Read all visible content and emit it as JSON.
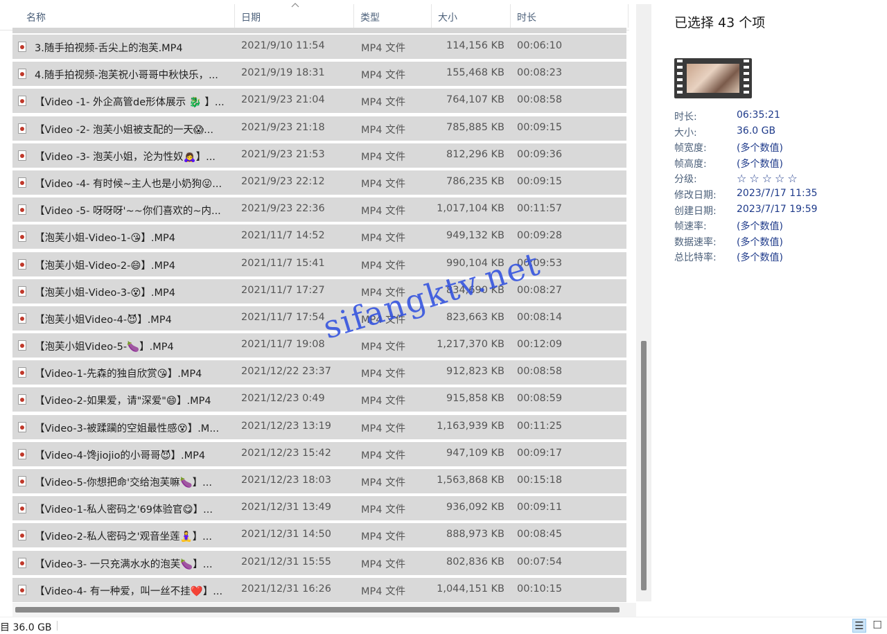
{
  "columns": {
    "name": "名称",
    "date": "日期",
    "type": "类型",
    "size": "大小",
    "duration": "时长"
  },
  "rows": [
    {
      "name": "3.随手拍视频-舌尖上的泡芙.MP4",
      "date": "2021/9/10 11:54",
      "type": "MP4 文件",
      "size": "114,156 KB",
      "duration": "00:06:10"
    },
    {
      "name": "4.随手拍视频-泡芙祝小哥哥中秋快乐，...",
      "date": "2021/9/19 18:31",
      "type": "MP4 文件",
      "size": "155,468 KB",
      "duration": "00:08:23"
    },
    {
      "name": "【Video -1- 外企高管de形体展示 🐉 】...",
      "date": "2021/9/23 21:04",
      "type": "MP4 文件",
      "size": "764,107 KB",
      "duration": "00:08:58"
    },
    {
      "name": "【Video -2- 泡芙小姐被支配的一天😱...",
      "date": "2021/9/23 21:18",
      "type": "MP4 文件",
      "size": "785,885 KB",
      "duration": "00:09:15"
    },
    {
      "name": "【Video -3- 泡芙小姐，沦为性奴🙇‍♀️】...",
      "date": "2021/9/23 21:53",
      "type": "MP4 文件",
      "size": "812,296 KB",
      "duration": "00:09:36"
    },
    {
      "name": "【Video -4- 有时候~主人也是小奶狗😜...",
      "date": "2021/9/23 22:12",
      "type": "MP4 文件",
      "size": "786,235 KB",
      "duration": "00:09:15"
    },
    {
      "name": "【Video -5- 呀呀呀'~~你们喜欢的~内...",
      "date": "2021/9/23 22:36",
      "type": "MP4 文件",
      "size": "1,017,104 KB",
      "duration": "00:11:57"
    },
    {
      "name": "【泡芙小姐-Video-1-😘】.MP4",
      "date": "2021/11/7 14:52",
      "type": "MP4 文件",
      "size": "949,132 KB",
      "duration": "00:09:28"
    },
    {
      "name": "【泡芙小姐-Video-2-😄】.MP4",
      "date": "2021/11/7 15:41",
      "type": "MP4 文件",
      "size": "990,104 KB",
      "duration": "00:09:53"
    },
    {
      "name": "【泡芙小姐-Video-3-😵】.MP4",
      "date": "2021/11/7 17:27",
      "type": "MP4 文件",
      "size": "834,690 KB",
      "duration": "00:08:27"
    },
    {
      "name": "【泡芙小姐Video-4-😈】.MP4",
      "date": "2021/11/7 17:54",
      "type": "MP4 文件",
      "size": "823,663 KB",
      "duration": "00:08:14"
    },
    {
      "name": "【泡芙小姐Video-5-🍆】.MP4",
      "date": "2021/11/7 19:08",
      "type": "MP4 文件",
      "size": "1,217,370 KB",
      "duration": "00:12:09"
    },
    {
      "name": "【Video-1-先森的独自欣赏😘】.MP4",
      "date": "2021/12/22 23:37",
      "type": "MP4 文件",
      "size": "912,823 KB",
      "duration": "00:08:58"
    },
    {
      "name": "【Video-2-如果爱，请\"深爱\"😄】.MP4",
      "date": "2021/12/23 0:49",
      "type": "MP4 文件",
      "size": "915,858 KB",
      "duration": "00:08:59"
    },
    {
      "name": "【Video-3-被蹂躏的空姐最性感😵】.M...",
      "date": "2021/12/23 13:19",
      "type": "MP4 文件",
      "size": "1,163,939 KB",
      "duration": "00:11:25"
    },
    {
      "name": "【Video-4-馋jiojio的小哥哥😈】.MP4",
      "date": "2021/12/23 15:42",
      "type": "MP4 文件",
      "size": "947,109 KB",
      "duration": "00:09:17"
    },
    {
      "name": "【Video-5-你想把命'交给泡芙嘛🍆】...",
      "date": "2021/12/23 18:03",
      "type": "MP4 文件",
      "size": "1,563,868 KB",
      "duration": "00:15:18"
    },
    {
      "name": "【Video-1-私人密码之'69体验官😋】...",
      "date": "2021/12/31 13:49",
      "type": "MP4 文件",
      "size": "936,092 KB",
      "duration": "00:09:11"
    },
    {
      "name": "【Video-2-私人密码之'观音坐莲🧘‍♀️】...",
      "date": "2021/12/31 14:50",
      "type": "MP4 文件",
      "size": "888,973 KB",
      "duration": "00:08:45"
    },
    {
      "name": "【Video-3- 一只充满水水的泡芙🍆】...",
      "date": "2021/12/31 15:55",
      "type": "MP4 文件",
      "size": "802,836 KB",
      "duration": "00:07:54"
    },
    {
      "name": "【Video-4- 有一种爱，叫一丝不挂❤️】...",
      "date": "2021/12/31 16:26",
      "type": "MP4 文件",
      "size": "1,044,151 KB",
      "duration": "00:10:15"
    }
  ],
  "watermark": "sifangktv.net",
  "details": {
    "selection_title": "已选择 43 个项",
    "props": [
      {
        "k": "时长:",
        "v": "06:35:21"
      },
      {
        "k": "大小:",
        "v": "36.0 GB"
      },
      {
        "k": "帧宽度:",
        "v": "(多个数值)"
      },
      {
        "k": "帧高度:",
        "v": "(多个数值)"
      },
      {
        "k": "分级:",
        "v": "☆☆☆☆☆"
      },
      {
        "k": "修改日期:",
        "v": "2023/7/17 11:35"
      },
      {
        "k": "创建日期:",
        "v": "2023/7/17 19:59"
      },
      {
        "k": "帧速率:",
        "v": "(多个数值)"
      },
      {
        "k": "数据速率:",
        "v": "(多个数值)"
      },
      {
        "k": "总比特率:",
        "v": "(多个数值)"
      }
    ]
  },
  "statusbar": {
    "text": "目 36.0 GB"
  },
  "icons": {
    "file": "video-file-icon",
    "sort": "sort-up-caret-icon",
    "details_view": "details-view-icon",
    "large_icons_view": "large-icons-view-icon"
  }
}
